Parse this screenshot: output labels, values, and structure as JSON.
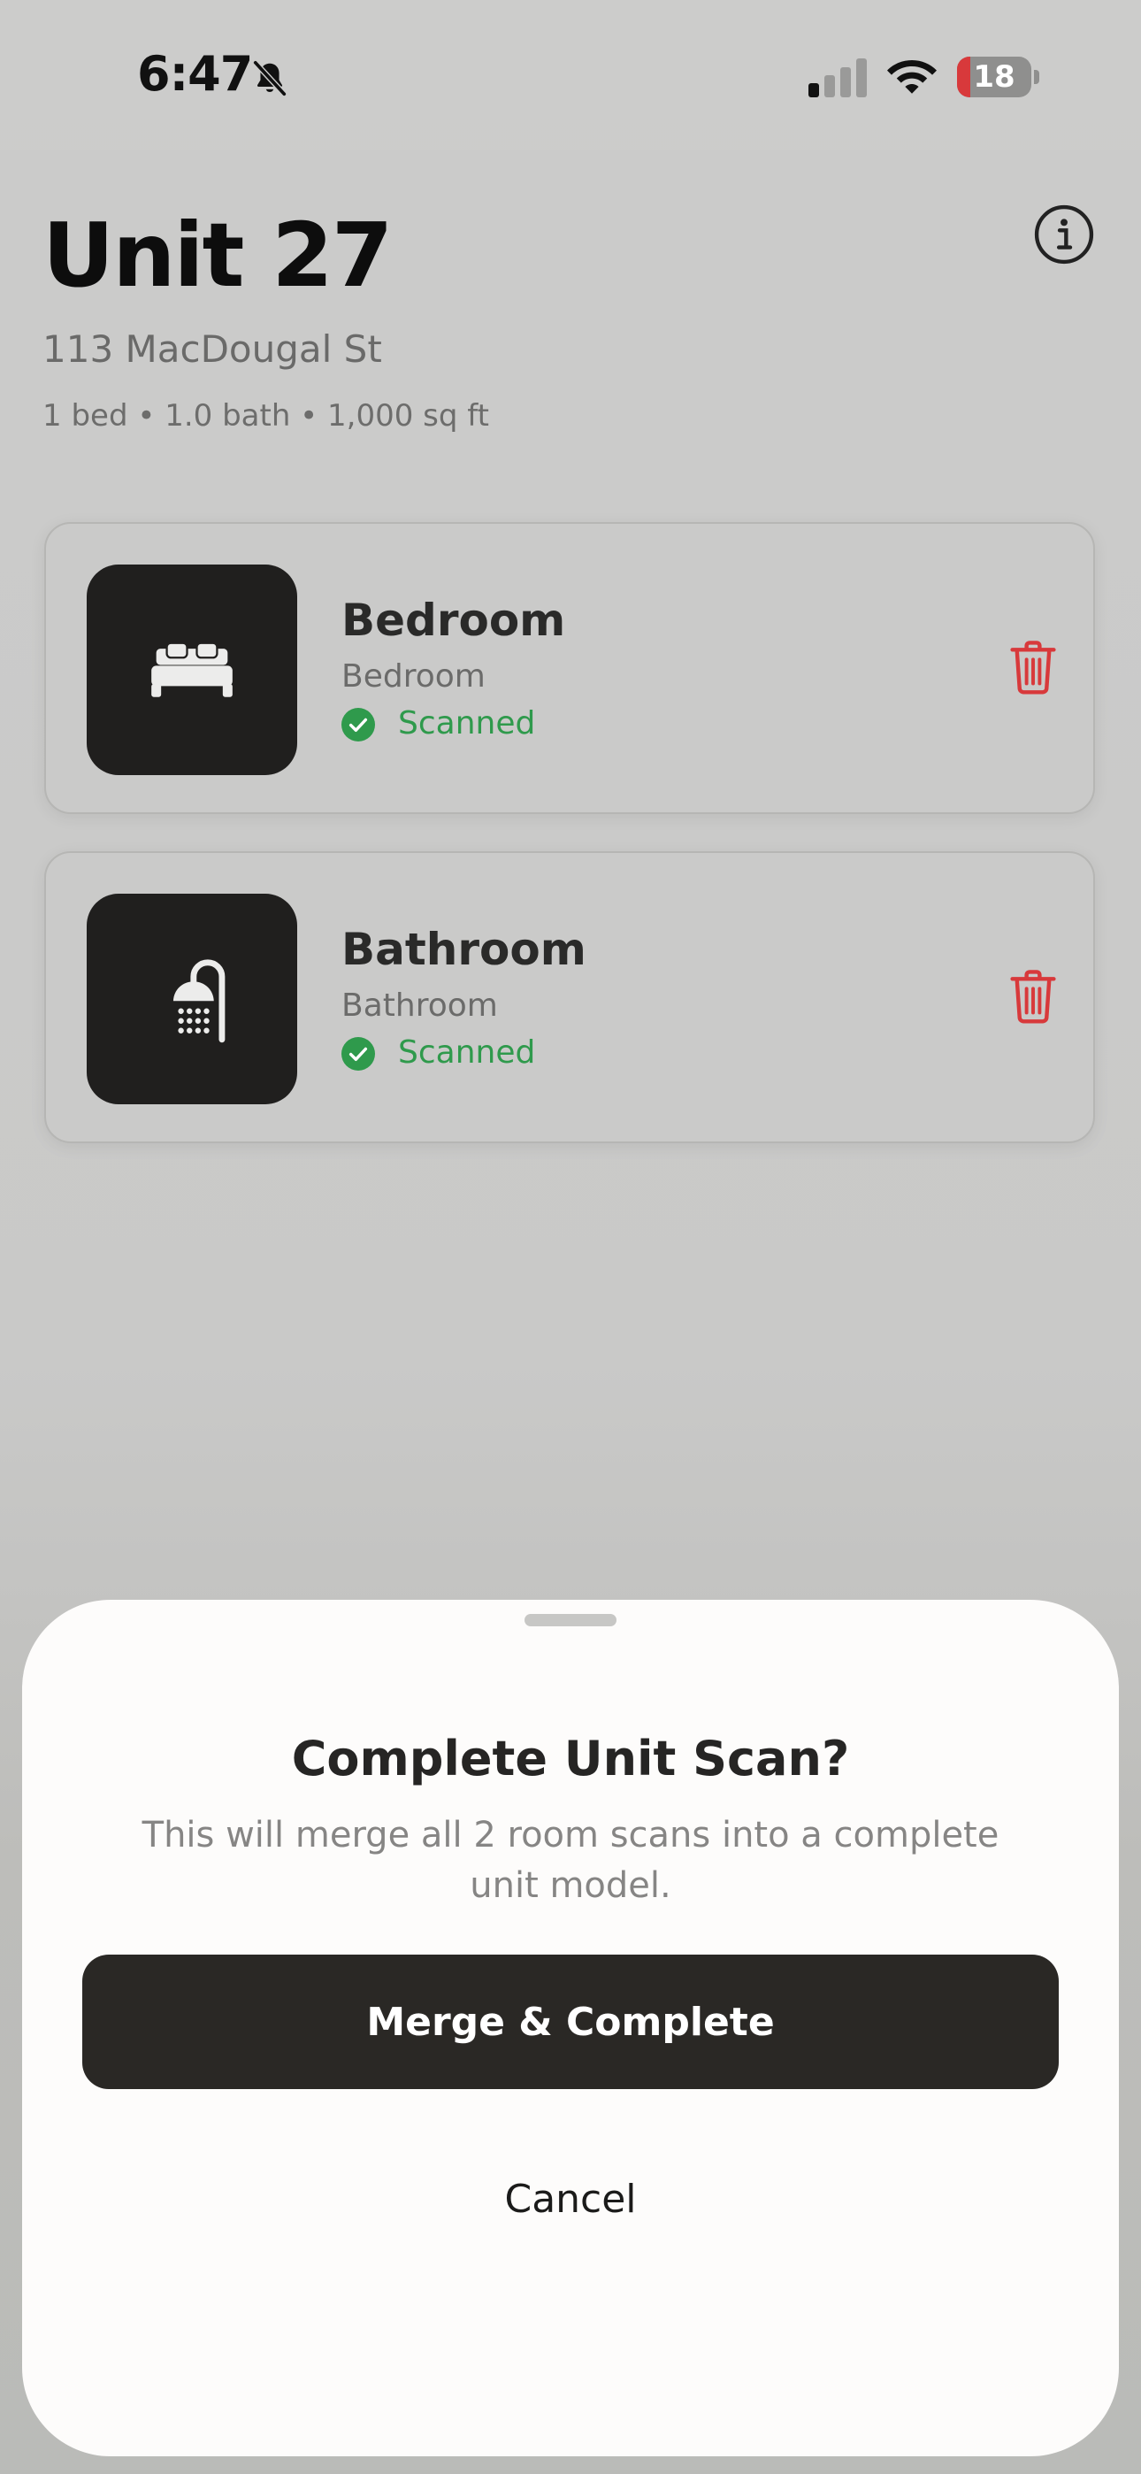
{
  "status_bar": {
    "time": "6:47",
    "battery_level": "18",
    "battery_fraction": 0.18,
    "icons": [
      "bell-slash-icon",
      "cellular-signal-icon",
      "wifi-icon",
      "battery-icon"
    ]
  },
  "header": {
    "title": "Unit 27",
    "address": "113 MacDougal St",
    "details": "1 bed • 1.0 bath • 1,000 sq ft",
    "info_icon": "info-circle-icon"
  },
  "rooms": [
    {
      "name": "Bedroom",
      "type": "Bedroom",
      "status": "Scanned",
      "icon": "bed-icon",
      "delete_icon": "trash-icon"
    },
    {
      "name": "Bathroom",
      "type": "Bathroom",
      "status": "Scanned",
      "icon": "shower-icon",
      "delete_icon": "trash-icon"
    }
  ],
  "sheet": {
    "title": "Complete Unit Scan?",
    "message": "This will merge all 2 room scans into a complete unit model.",
    "primary_label": "Merge & Complete",
    "cancel_label": "Cancel"
  },
  "colors": {
    "success": "#2f9a4c",
    "danger": "#d8393b",
    "primary_button": "#2a2825",
    "sheet_background": "#fdfcfb"
  }
}
